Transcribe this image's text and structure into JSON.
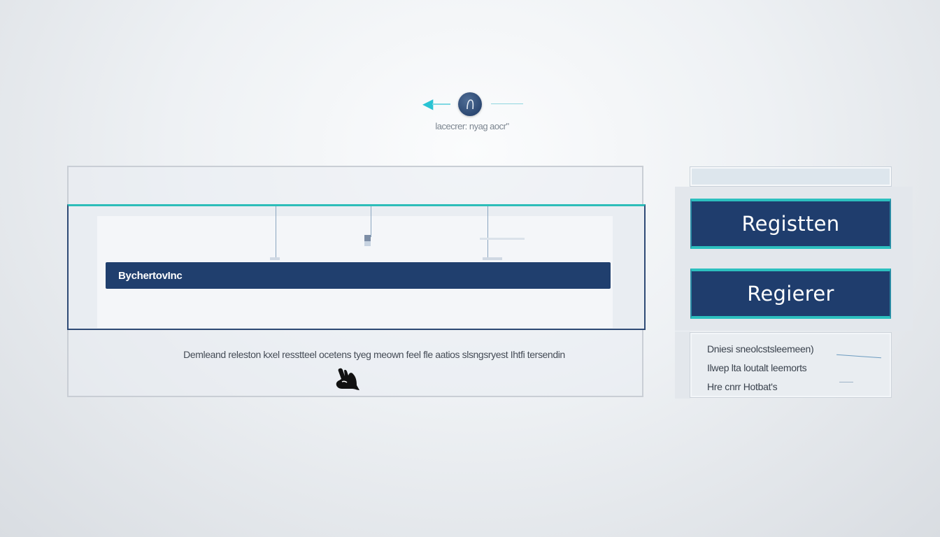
{
  "stepper": {
    "caption": "lacecrer: nyag aocr\"",
    "icon": "user-silhouette-icon"
  },
  "main": {
    "nav_bar_label": "BychertovInc",
    "description": "Demleand releston kxel resstteel ocetens tyeg meown feel fle aatios slsngsryest Ihtfi tersendin",
    "cursor_icon": "hand-cursor-icon"
  },
  "right": {
    "buttons": [
      {
        "label": "Registten"
      },
      {
        "label": "Regierer"
      }
    ],
    "info_lines": [
      "Dniesi sneolcstsleemeen)",
      "Ilwep lta loutalt leemorts",
      "Hre cnrr Hotbat's"
    ]
  },
  "colors": {
    "navy": "#1f3d6d",
    "teal_accent": "#2cc0bf",
    "background": "#eef1f4"
  }
}
